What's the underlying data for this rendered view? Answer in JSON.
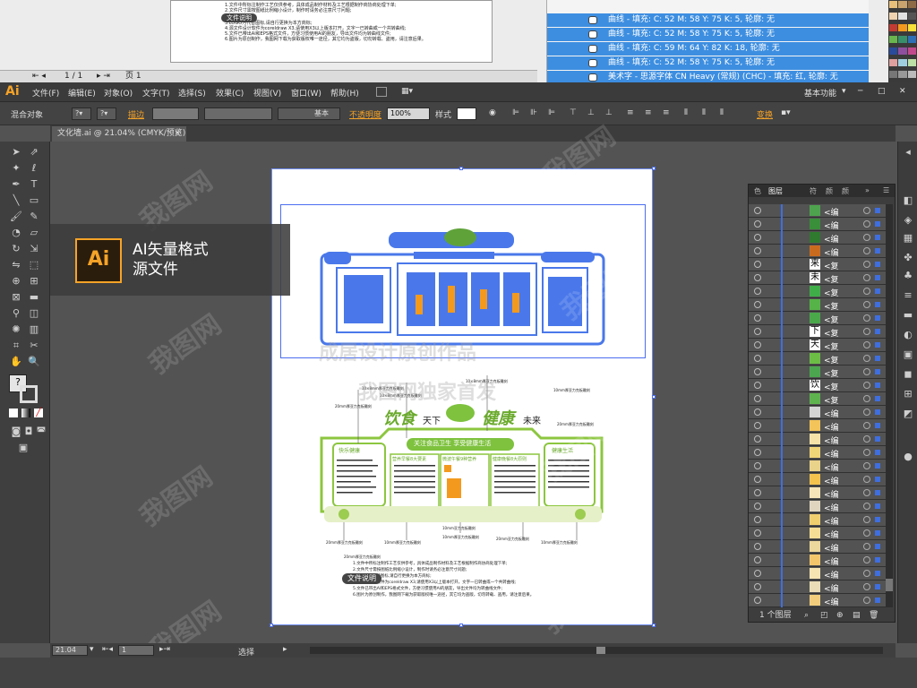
{
  "background": {
    "pager": {
      "pages": "1 / 1",
      "page_label": "页 1"
    },
    "notes": [
      "1.文件中所标注制作工艺仅供参考，具体成品制作材料及工艺根据制作商协商处理下单;",
      "2.文件尺寸需按图纸比例缩小设计，制作时请务必注意尺寸问题;",
      "3.LOGO为代替图标,请自行更换为本方商标;",
      "4.源文件设计软件为coreldraw X3,请使用X3以上版本打开，文字一已转曲或一个共转曲线;",
      "5.文件已带出AI和EPS格式文件，方便习惯使用AI的朋友，导出文件均为转曲线文件;",
      "6.图片为原创制作，我图网下载为获取版权唯一途径，其它均为盗版，切勿转载、盗用，请注意后果。"
    ],
    "notes_badge": "文件说明",
    "object_list": [
      "曲线 - 填充: C: 52 M: 58 Y: 75 K: 5, 轮廓: 无",
      "曲线 - 填充: C: 52 M: 58 Y: 75 K: 5, 轮廓: 无",
      "曲线 - 填充: C: 59 M: 64 Y: 82 K: 18, 轮廓: 无",
      "曲线 - 填充: C: 52 M: 58 Y: 75 K: 5, 轮廓: 无",
      "美术字 - 思源字体 CN Heavy (常规) (CHC) - 填充: 红, 轮廓: 无"
    ]
  },
  "app": {
    "logo": "Ai",
    "menu": [
      "文件(F)",
      "编辑(E)",
      "对象(O)",
      "文字(T)",
      "选择(S)",
      "效果(C)",
      "视图(V)",
      "窗口(W)",
      "帮助(H)"
    ],
    "workspace": "基本功能",
    "window_buttons": [
      "─",
      "□",
      "✕"
    ]
  },
  "control_bar": {
    "label_mixed": "混合对象",
    "stroke_label": "描边",
    "stroke_style": "基本",
    "opacity_label": "不透明度",
    "opacity_value": "100%",
    "style_label": "样式",
    "transform_label": "变换"
  },
  "document": {
    "tab_title": "文化墙.ai @ 21.04% (CMYK/预览)",
    "zoom": "21.04",
    "artboard_num": "1",
    "status_text": "选择"
  },
  "overlay": {
    "logo": "Ai",
    "line1": "AI矢量格式",
    "line2": "源文件",
    "watermark1": "成居设计原创作品",
    "watermark2": "我图网独家首发",
    "watermark_tile": "我图网"
  },
  "design": {
    "title_left": "饮食",
    "title_mid": "天下",
    "title_right": "健康",
    "title_end": "未来",
    "subtitle": "关注食品卫生  享受健康生活",
    "panels": [
      "快乐健康",
      "营养早餐8大要素",
      "微波午餐9种营养",
      "健康晚餐8大原则",
      "健康生活"
    ],
    "dims": [
      "10×8mm厚亚力克板雕刻",
      "10×8mm厚亚力克板雕刻",
      "20mm厚亚力克板雕刻",
      "10×8mm厚亚力克板雕刻",
      "10mm厚亚力克板雕刻",
      "20mm厚亚力克板雕刻",
      "20mm厚亚力克板雕刻",
      "10mm厚亚力克板雕刻",
      "10mm厚亚力克板雕刻",
      "20mm亚力克板雕刻",
      "10mm厚亚力克板雕刻",
      "20mm厚亚力克板雕刻",
      "10mm亚力克板雕刻"
    ],
    "notes_badge": "文件说明"
  },
  "layers_panel": {
    "tabs": [
      "色",
      "图层",
      "符",
      "颜",
      "颜"
    ],
    "rows": [
      {
        "thumb": "",
        "name": "<编"
      },
      {
        "thumb": "",
        "name": "<编"
      },
      {
        "thumb": "",
        "name": "<编"
      },
      {
        "thumb": "",
        "name": "<编"
      },
      {
        "thumb": "来",
        "name": "<复"
      },
      {
        "thumb": "未",
        "name": "<复"
      },
      {
        "thumb": "",
        "name": "<复"
      },
      {
        "thumb": "",
        "name": "<复"
      },
      {
        "thumb": "",
        "name": "<复"
      },
      {
        "thumb": "下",
        "name": "<复"
      },
      {
        "thumb": "天",
        "name": "<复"
      },
      {
        "thumb": "",
        "name": "<复"
      },
      {
        "thumb": "",
        "name": "<复"
      },
      {
        "thumb": "饮",
        "name": "<复"
      },
      {
        "thumb": "",
        "name": "<复"
      },
      {
        "thumb": "",
        "name": "<编"
      },
      {
        "thumb": "",
        "name": "<编"
      },
      {
        "thumb": "",
        "name": "<编"
      },
      {
        "thumb": "",
        "name": "<编"
      },
      {
        "thumb": "",
        "name": "<编"
      },
      {
        "thumb": "",
        "name": "<编"
      },
      {
        "thumb": "",
        "name": "<编"
      },
      {
        "thumb": "",
        "name": "<编"
      },
      {
        "thumb": "",
        "name": "<编"
      },
      {
        "thumb": "",
        "name": "<编"
      },
      {
        "thumb": "",
        "name": "<编"
      },
      {
        "thumb": "",
        "name": "<编"
      },
      {
        "thumb": "",
        "name": "<编"
      },
      {
        "thumb": "",
        "name": "<编"
      },
      {
        "thumb": "",
        "name": "<编"
      }
    ],
    "count": "1 个图层"
  },
  "colors": {
    "accent": "#f6a327",
    "select": "#4c6ef0",
    "green": "#7ec23e",
    "blue_layer": "#3f6ede"
  }
}
